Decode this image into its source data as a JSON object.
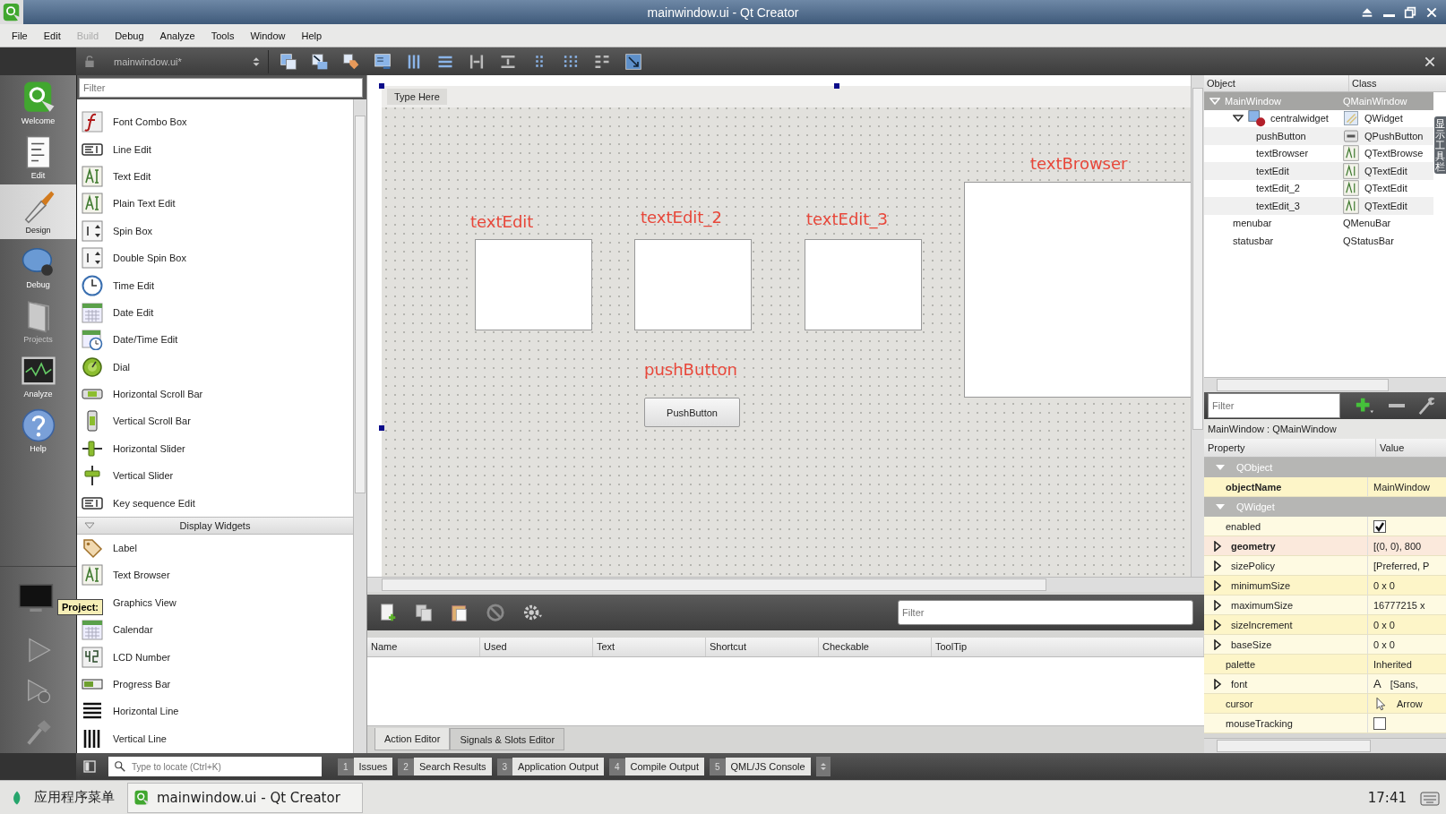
{
  "window": {
    "title": "mainwindow.ui - Qt Creator"
  },
  "menu": [
    {
      "label": "File",
      "disabled": false
    },
    {
      "label": "Edit",
      "disabled": false
    },
    {
      "label": "Build",
      "disabled": true
    },
    {
      "label": "Debug",
      "disabled": false
    },
    {
      "label": "Analyze",
      "disabled": false
    },
    {
      "label": "Tools",
      "disabled": false
    },
    {
      "label": "Window",
      "disabled": false
    },
    {
      "label": "Help",
      "disabled": false
    }
  ],
  "toolbar": {
    "file": "mainwindow.ui*"
  },
  "modes": [
    {
      "label": "Welcome",
      "selected": false,
      "disabled": false
    },
    {
      "label": "Edit",
      "selected": false,
      "disabled": false
    },
    {
      "label": "Design",
      "selected": true,
      "disabled": false
    },
    {
      "label": "Debug",
      "selected": false,
      "disabled": false
    },
    {
      "label": "Projects",
      "selected": false,
      "disabled": true
    },
    {
      "label": "Analyze",
      "selected": false,
      "disabled": false
    },
    {
      "label": "Help",
      "selected": false,
      "disabled": false
    }
  ],
  "tooltip": "Project:",
  "widget_box": {
    "placeholder": "Filter",
    "items": [
      "Font Combo Box",
      "Line Edit",
      "Text Edit",
      "Plain Text Edit",
      "Spin Box",
      "Double Spin Box",
      "Time Edit",
      "Date Edit",
      "Date/Time Edit",
      "Dial",
      "Horizontal Scroll Bar",
      "Vertical Scroll Bar",
      "Horizontal Slider",
      "Vertical Slider",
      "Key sequence Edit"
    ],
    "categories": [
      {
        "title": "Display Widgets",
        "expanded": true,
        "items": [
          "Label",
          "Text Browser",
          "Graphics View",
          "Calendar",
          "LCD Number",
          "Progress Bar",
          "Horizontal Line",
          "Vertical Line"
        ]
      }
    ]
  },
  "form": {
    "menu_placeholder": "Type Here",
    "widgets": [
      {
        "kind": "text_edit",
        "caption": "textEdit"
      },
      {
        "kind": "text_edit",
        "caption": "textEdit_2"
      },
      {
        "kind": "text_edit",
        "caption": "textEdit_3"
      },
      {
        "kind": "text_browser",
        "caption": "textBrowser"
      },
      {
        "kind": "push_button",
        "caption": "pushButton",
        "text": "PushButton"
      }
    ]
  },
  "action_editor": {
    "placeholder": "Filter",
    "columns": [
      "Name",
      "Used",
      "Text",
      "Shortcut",
      "Checkable",
      "ToolTip"
    ],
    "tabs": [
      {
        "label": "Action Editor",
        "selected": true
      },
      {
        "label": "Signals & Slots Editor",
        "selected": false
      }
    ]
  },
  "object_inspector": {
    "columns": [
      "Object",
      "Class"
    ],
    "tree": [
      {
        "object": "MainWindow",
        "class": "QMainWindow",
        "selected": true,
        "expanded": true,
        "children": [
          {
            "object": "centralwidget",
            "class": "QWidget",
            "selected": false,
            "expanded": true,
            "children": [
              {
                "object": "pushButton",
                "class": "QPushButton",
                "selected": false
              },
              {
                "object": "textBrowser",
                "class": "QTextBrowse",
                "selected": false
              },
              {
                "object": "textEdit",
                "class": "QTextEdit",
                "selected": false
              },
              {
                "object": "textEdit_2",
                "class": "QTextEdit",
                "selected": false
              },
              {
                "object": "textEdit_3",
                "class": "QTextEdit",
                "selected": false
              }
            ]
          },
          {
            "object": "menubar",
            "class": "QMenuBar",
            "selected": false
          },
          {
            "object": "statusbar",
            "class": "QStatusBar",
            "selected": false
          }
        ]
      }
    ],
    "placeholder": "Filter"
  },
  "side_tab": "显示工具栏",
  "property_editor": {
    "title": "MainWindow : QMainWindow",
    "columns": [
      "Property",
      "Value"
    ],
    "rows": [
      {
        "kind": "group",
        "name": "QObject",
        "expanded": true
      },
      {
        "kind": "text",
        "name": "objectName",
        "value": "MainWindow",
        "bold": true,
        "expandable": false
      },
      {
        "kind": "group",
        "name": "QWidget",
        "expanded": true
      },
      {
        "kind": "check",
        "name": "enabled",
        "checked": true,
        "bold": false,
        "expandable": false
      },
      {
        "kind": "text",
        "name": "geometry",
        "value": "[(0, 0), 800",
        "bold": true,
        "expandable": true
      },
      {
        "kind": "text",
        "name": "sizePolicy",
        "value": "[Preferred, P",
        "bold": false,
        "expandable": true
      },
      {
        "kind": "text",
        "name": "minimumSize",
        "value": "0 x 0",
        "bold": false,
        "expandable": true
      },
      {
        "kind": "text",
        "name": "maximumSize",
        "value": "16777215 x",
        "bold": false,
        "expandable": true
      },
      {
        "kind": "text",
        "name": "sizeIncrement",
        "value": "0 x 0",
        "bold": false,
        "expandable": true
      },
      {
        "kind": "text",
        "name": "baseSize",
        "value": "0 x 0",
        "bold": false,
        "expandable": true
      },
      {
        "kind": "text",
        "name": "palette",
        "value": "Inherited",
        "bold": false,
        "expandable": false
      },
      {
        "kind": "font",
        "name": "font",
        "value": "[Sans,",
        "glyph": "A",
        "bold": false,
        "expandable": true
      },
      {
        "kind": "cursor",
        "name": "cursor",
        "value": "Arrow",
        "bold": false,
        "expandable": false
      },
      {
        "kind": "check",
        "name": "mouseTracking",
        "checked": false,
        "bold": false,
        "expandable": false
      }
    ]
  },
  "output_bar": {
    "placeholder": "Type to locate (Ctrl+K)",
    "panes": [
      {
        "number": "1",
        "label": "Issues"
      },
      {
        "number": "2",
        "label": "Search Results"
      },
      {
        "number": "3",
        "label": "Application Output"
      },
      {
        "number": "4",
        "label": "Compile Output"
      },
      {
        "number": "5",
        "label": "QML/JS Console"
      }
    ]
  },
  "taskbar": {
    "menu": "应用程序菜单",
    "task": "mainwindow.ui - Qt Creator",
    "clock": "17:41"
  }
}
